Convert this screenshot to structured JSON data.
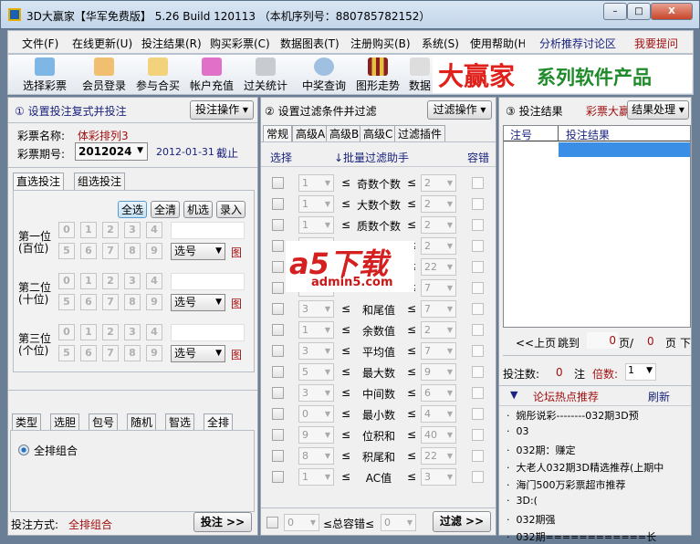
{
  "window": {
    "title": "3D大赢家【华军免费版】 5.26 Build 120113 （本机序列号：880785782152）",
    "min": "–",
    "max": "□",
    "close": "X"
  },
  "menu": [
    "文件(F)",
    "在线更新(U)",
    "投注结果(R)",
    "购买彩票(C)",
    "数据图表(T)",
    "注册购买(B)",
    "系统(S)",
    "使用帮助(H)"
  ],
  "menu_links": {
    "forum": "分析推荐讨论区",
    "ask": "我要提问"
  },
  "toolbar": [
    "选择彩票",
    "会员登录",
    "参与合买",
    "帐户充值",
    "过关统计",
    "中奖查询",
    "图形走势",
    "数据"
  ],
  "banner": {
    "brand": "大赢家",
    "slogan": "系列软件产品"
  },
  "panel1": {
    "title": "① 设置投注复式并投注",
    "op": "投注操作 ▾",
    "name_label": "彩票名称:",
    "name_value": "体彩排列3",
    "issue_label": "彩票期号:",
    "issue_value": "2012024",
    "deadline": "2012-01-31",
    "deadline_suffix": "截止",
    "tabs": [
      "直选投注",
      "组选投注"
    ],
    "actions": [
      "全选",
      "全清",
      "机选",
      "录入"
    ],
    "positions": [
      {
        "l1": "第一位",
        "l2": "(百位)"
      },
      {
        "l1": "第二位",
        "l2": "(十位)"
      },
      {
        "l1": "第三位",
        "l2": "(个位)"
      }
    ],
    "digits": [
      "0",
      "1",
      "2",
      "3",
      "4",
      "5",
      "6",
      "7",
      "8",
      "9"
    ],
    "select_label": "选号",
    "chart_label": "图",
    "tabs2": [
      "类型",
      "选胆",
      "包号",
      "随机",
      "智选",
      "全排"
    ],
    "radio": "全排组合",
    "mode_label": "投注方式:",
    "mode_value": "全排组合",
    "submit": "投注 >>"
  },
  "panel2": {
    "title": "② 设置过滤条件并过滤",
    "op": "过滤操作 ▾",
    "tabs": [
      "常规",
      "高级A",
      "高级B",
      "高级C",
      "过滤插件"
    ],
    "col_select": "选择",
    "col_helper": "↓批量过滤助手",
    "col_tol": "容错",
    "le": "≤",
    "rows": [
      {
        "lo": "1",
        "label": "奇数个数",
        "hi": "2"
      },
      {
        "lo": "1",
        "label": "大数个数",
        "hi": "2"
      },
      {
        "lo": "1",
        "label": "质数个数",
        "hi": "2"
      },
      {
        "lo": "",
        "label": "",
        "hi": "2"
      },
      {
        "lo": "",
        "label": "",
        "hi": "22"
      },
      {
        "lo": "",
        "label": "",
        "hi": "7"
      },
      {
        "lo": "3",
        "label": "和尾值",
        "hi": "7"
      },
      {
        "lo": "1",
        "label": "余数值",
        "hi": "2"
      },
      {
        "lo": "3",
        "label": "平均值",
        "hi": "7"
      },
      {
        "lo": "5",
        "label": "最大数",
        "hi": "9"
      },
      {
        "lo": "3",
        "label": "中间数",
        "hi": "6"
      },
      {
        "lo": "0",
        "label": "最小数",
        "hi": "4"
      },
      {
        "lo": "9",
        "label": "位积和",
        "hi": "40"
      },
      {
        "lo": "8",
        "label": "积尾和",
        "hi": "22"
      },
      {
        "lo": "1",
        "label": "AC值",
        "hi": "3"
      }
    ],
    "total_lo": "0",
    "total_label": "≤总容错≤",
    "total_hi": "0",
    "submit": "过滤 >>"
  },
  "watermark": {
    "logo": "a5下载",
    "url": "admin5.com"
  },
  "panel3": {
    "title": "③ 投注结果",
    "ad": "彩票大赢",
    "op": "结果处理 ▾",
    "cols": [
      "注号",
      "投注结果"
    ],
    "prev": "<<上页",
    "jump": "跳到",
    "page": "0",
    "page_sep": "页/",
    "total": "0",
    "page_suffix": "页",
    "next": "下",
    "count_label": "投注数:",
    "count": "0",
    "unit": "注",
    "mult_label": "倍数:",
    "mult": "1",
    "forum_title": "论坛热点推荐",
    "refresh": "刷新",
    "posts": [
      "婉彤说彩--------032期3D预",
      "03",
      "032期：赚定",
      "大老人032期3D精选推荐(上期中",
      "海门500万彩票超市推荐",
      "3D:(",
      "032期强",
      "032期============长"
    ]
  }
}
